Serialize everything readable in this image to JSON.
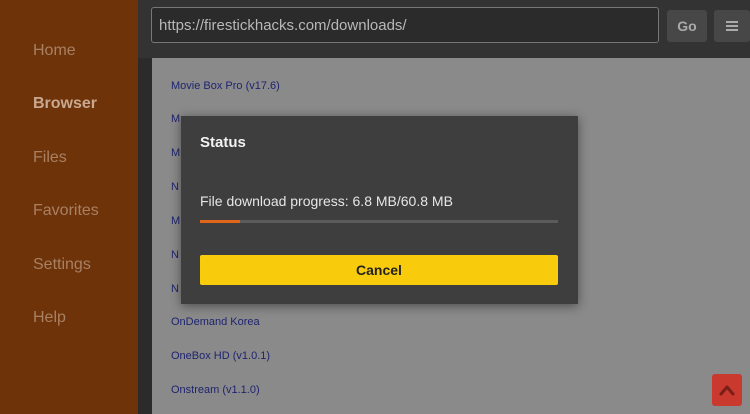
{
  "sidebar": {
    "items": [
      {
        "label": "Home"
      },
      {
        "label": "Browser"
      },
      {
        "label": "Files"
      },
      {
        "label": "Favorites"
      },
      {
        "label": "Settings"
      },
      {
        "label": "Help"
      }
    ],
    "active": "Browser"
  },
  "topbar": {
    "url": "https://firestickhacks.com/downloads/",
    "go_label": "Go",
    "menu_icon": "hamburger-menu-icon"
  },
  "page": {
    "links": [
      "Movie Box Pro (v17.6)",
      "M",
      "M",
      "N",
      "M",
      "N",
      "N",
      "OnDemand Korea",
      "OneBox HD (v1.0.1)",
      "Onstream (v1.1.0)"
    ]
  },
  "dialog": {
    "title": "Status",
    "message": "File download progress: 6.8 MB/60.8 MB",
    "progress_fraction": 0.112,
    "cancel_label": "Cancel"
  },
  "colors": {
    "sidebar_bg": "#6e3309",
    "progress": "#e0661c",
    "cancel_button": "#f8cc0d",
    "scroll_top_button": "#c9392e"
  },
  "scroll_top": {
    "icon": "chevron-up-icon"
  }
}
